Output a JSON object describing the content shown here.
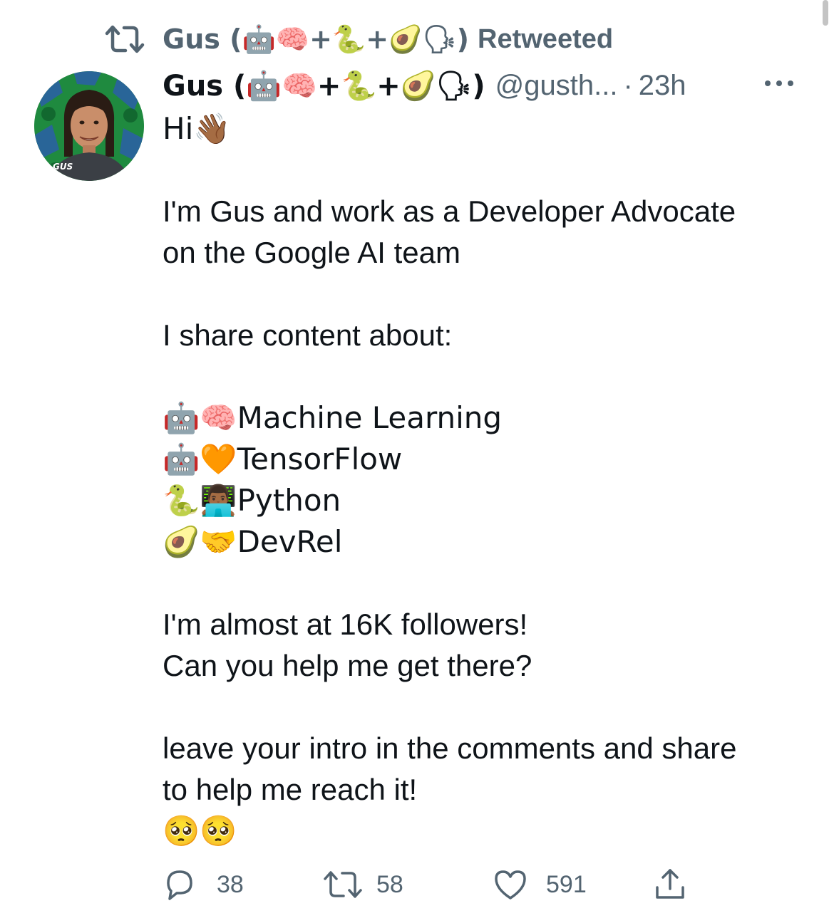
{
  "retweet_banner": {
    "retweeter": "Gus (🤖🧠+🐍+🥑🗣)",
    "label": "Retweeted"
  },
  "tweet": {
    "display_name": "Gus (🤖🧠+🐍+🥑🗣)",
    "handle": "@gusth...",
    "separator": "·",
    "time": "23h",
    "avatar_caption": "GUS",
    "lines": {
      "l1": "Hi👋🏾",
      "l2": "I'm Gus and work as a Developer Advocate",
      "l3": "on the Google AI team",
      "l4": "I share content about:",
      "l5": "🤖🧠Machine Learning",
      "l6": "🤖🧡TensorFlow",
      "l7": "🐍👨🏾‍💻Python",
      "l8": "🥑🤝DevRel",
      "l9": "I'm almost at 16K followers!",
      "l10": "Can you help me get there?",
      "l11": "leave your intro in the comments and share",
      "l12": "to help me reach it!",
      "l13": "🥺🥺"
    }
  },
  "actions": {
    "replies": "38",
    "retweets": "58",
    "likes": "591"
  },
  "icons": {
    "retweet": "retweet-icon",
    "reply": "reply-icon",
    "like": "heart-icon",
    "share": "share-icon",
    "more": "more-icon"
  },
  "colors": {
    "text": "#0f1419",
    "secondary": "#536471",
    "background": "#ffffff"
  }
}
